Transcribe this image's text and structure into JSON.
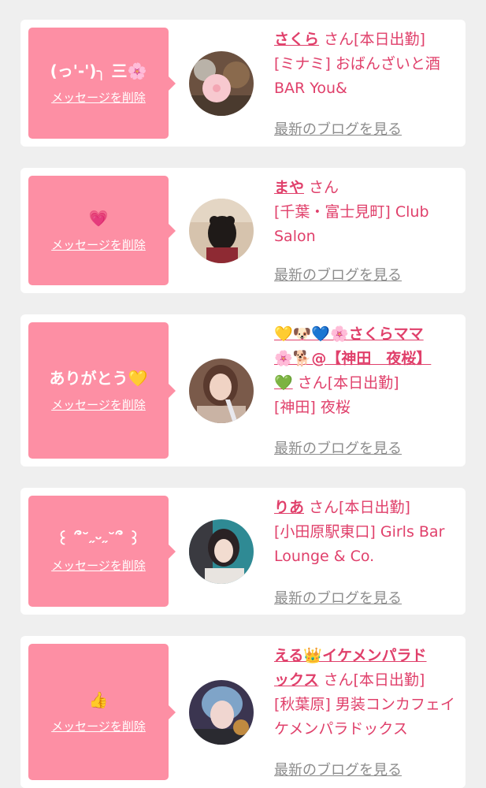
{
  "cards": [
    {
      "message": "(っ'-')╮ 三🌸",
      "delete_label": "メッセージを削除",
      "name": "さくら",
      "honorific": "さん",
      "status": "[本日出勤]",
      "shop": "[ミナミ] おばんざいと酒BAR You&",
      "blog_label": "最新のブログを見る"
    },
    {
      "message": "💗",
      "delete_label": "メッセージを削除",
      "name": "まや",
      "honorific": "さん",
      "status": "",
      "shop": "[千葉・富士見町] Club Salon",
      "blog_label": "最新のブログを見る"
    },
    {
      "message": "ありがとう💛",
      "delete_label": "メッセージを削除",
      "name_line1": "💛🐶💙🌸さくらママ",
      "name_line2": "🌸🐕@【神田　夜桜】",
      "name_line3": "💚",
      "honorific": "さん",
      "status": "[本日出勤]",
      "shop": "[神田] 夜桜",
      "blog_label": "最新のブログを見る"
    },
    {
      "message": "꒰ ՞˘˶ᵕ˶˘՞ ꒱",
      "delete_label": "メッセージを削除",
      "name": "りあ",
      "honorific": "さん",
      "status": "[本日出勤]",
      "shop": "[小田原駅東口] Girls Bar Lounge & Co.",
      "blog_label": "最新のブログを見る"
    },
    {
      "message": "👍",
      "delete_label": "メッセージを削除",
      "name_line1": "える👑イケメンパラド",
      "name_line2": "ックス",
      "honorific": "さん",
      "status": "[本日出勤]",
      "shop": "[秋葉原] 男装コンカフェイケメンパラドックス",
      "blog_label": "最新のブログを見る"
    }
  ],
  "colors": {
    "accent_pink": "#fd8fa4",
    "name_pink": "#e0406b",
    "muted_gray": "#8c8c8c",
    "background": "#efefef"
  }
}
